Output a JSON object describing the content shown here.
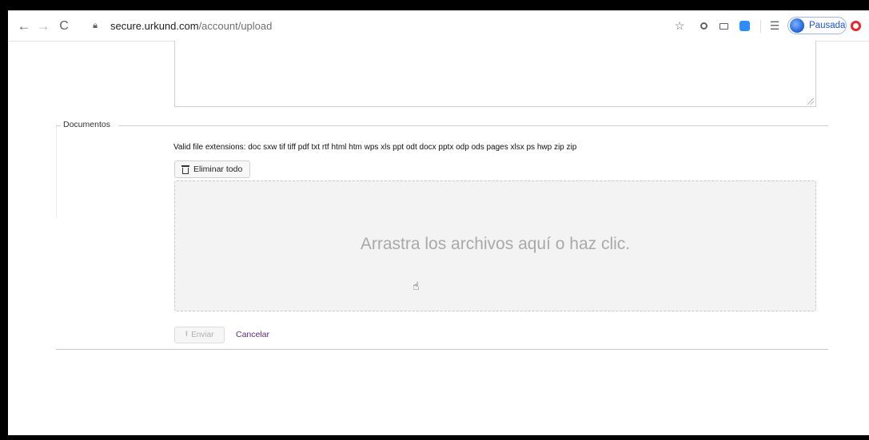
{
  "browser": {
    "url_host": "secure.urkund.com",
    "url_path": "/account/upload",
    "profile_label": "Pausada",
    "nav": {
      "back": "←",
      "forward": "→",
      "reload": "C"
    }
  },
  "form": {
    "section_legend": "Documentos",
    "valid_extensions": "Valid file extensions: doc sxw tif tiff pdf txt rtf html htm wps xls ppt odt docx pptx odp ods pages xlsx ps hwp zip zip",
    "delete_all_label": "Eliminar todo",
    "dropzone_message": "Arrastra los archivos aquí o haz clic.",
    "send_label": "Enviar",
    "cancel_label": "Cancelar"
  }
}
